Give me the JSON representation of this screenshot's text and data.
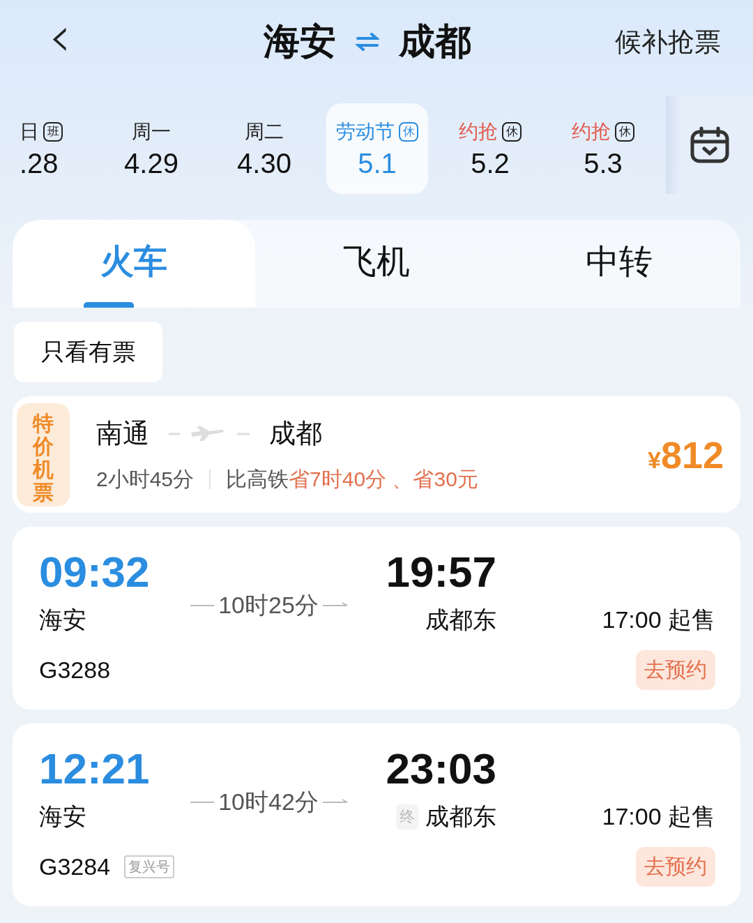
{
  "header": {
    "back": "‹",
    "from": "海安",
    "to": "成都",
    "action": "候补抢票"
  },
  "dates": [
    {
      "weekday": "日",
      "badge": "班",
      "date": ".28",
      "selected": false,
      "accent": false
    },
    {
      "weekday": "周一",
      "date": "4.29",
      "selected": false,
      "accent": false
    },
    {
      "weekday": "周二",
      "date": "4.30",
      "selected": false,
      "accent": false
    },
    {
      "weekday": "劳动节",
      "badge": "休",
      "date": "5.1",
      "selected": true,
      "accent": false
    },
    {
      "weekday": "约抢",
      "badge": "休",
      "date": "5.2",
      "selected": false,
      "accent": true
    },
    {
      "weekday": "约抢",
      "badge": "休",
      "date": "5.3",
      "selected": false,
      "accent": true
    }
  ],
  "modes": [
    {
      "label": "火车",
      "selected": true
    },
    {
      "label": "飞机",
      "selected": false
    },
    {
      "label": "中转",
      "selected": false
    }
  ],
  "filter": {
    "label": "只看有票"
  },
  "flight": {
    "badge": "特价机票",
    "from": "南通",
    "to": "成都",
    "duration": "2小时45分",
    "compare": "比高铁",
    "savings": "省7时40分 、省30元",
    "currency": "¥",
    "price": "812"
  },
  "trains": [
    {
      "depart": "09:32",
      "duration": "10时25分",
      "arrive": "19:57",
      "from": "海安",
      "terminal": false,
      "to": "成都东",
      "sale": "17:00 起售",
      "number": "G3288",
      "action": "去预约"
    },
    {
      "depart": "12:21",
      "duration": "10时42分",
      "arrive": "23:03",
      "from": "海安",
      "terminal": true,
      "terminal_mark": "终",
      "to": "成都东",
      "sale": "17:00 起售",
      "number": "G3284",
      "tag": "复兴号",
      "action": "去预约"
    }
  ]
}
